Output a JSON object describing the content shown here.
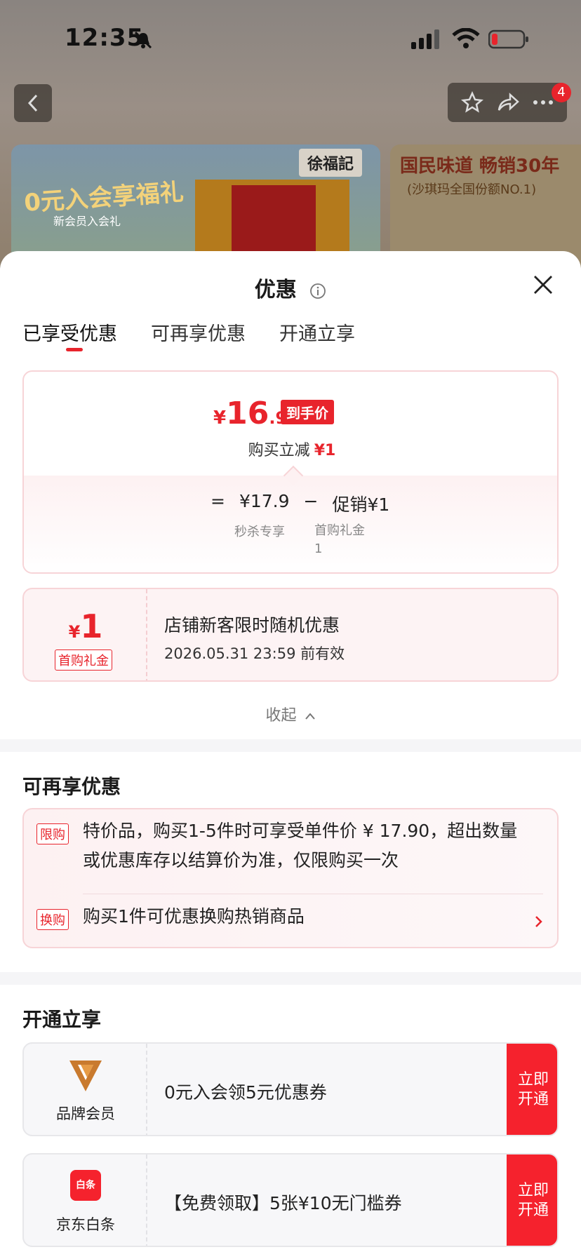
{
  "status_bar": {
    "time": "12:35"
  },
  "header": {
    "badge_count": "4"
  },
  "background_banner": {
    "promo_text": "0元入会享福礼",
    "promo_sub": "新会员入会礼",
    "brand": "徐福記",
    "slogan": "国民味道 畅销30年",
    "slogan_sub": "(沙琪玛全国份额NO.1)"
  },
  "sheet": {
    "title": "优惠",
    "tabs": [
      {
        "label": "已享受优惠"
      },
      {
        "label": "可再享优惠"
      },
      {
        "label": "开通立享"
      }
    ],
    "price_card": {
      "currency": "¥",
      "price_int": "16",
      "price_dec": ".9",
      "final_tag": "到手价",
      "reduce_label": "购买立减",
      "reduce_amount": "¥1",
      "eq": "=",
      "base_price": "¥17.9",
      "minus": "−",
      "promo": "促销¥1",
      "base_label": "秒杀专享",
      "promo_label": "首购礼金",
      "promo_label_value": "1"
    },
    "coupon": {
      "currency": "¥",
      "amount": "1",
      "tag": "首购礼金",
      "title": "店铺新客限时随机优惠",
      "expire": "2026.05.31 23:59 前有效"
    },
    "collapse_label": "收起",
    "more_section": {
      "title": "可再享优惠",
      "items": [
        {
          "tag": "限购",
          "text_line1": "特价品，购买1-5件时可享受单件价 ¥ 17.90，超出数量",
          "text_line2": "或优惠库存以结算价为准，仅限购买一次"
        },
        {
          "tag": "换购",
          "text": "购买1件可优惠换购热销商品"
        }
      ]
    },
    "open_section": {
      "title": "开通立享",
      "items": [
        {
          "name": "品牌会员",
          "text": "0元入会领5元优惠券",
          "button": "立即开通",
          "icon": "brand-v-icon"
        },
        {
          "name": "京东白条",
          "text": "【免费领取】5张¥10无门槛券",
          "button": "立即开通",
          "icon": "baitiao-icon",
          "icon_text": "白条"
        }
      ]
    }
  },
  "colors": {
    "accent": "#e8242c",
    "button": "#f5222d"
  }
}
